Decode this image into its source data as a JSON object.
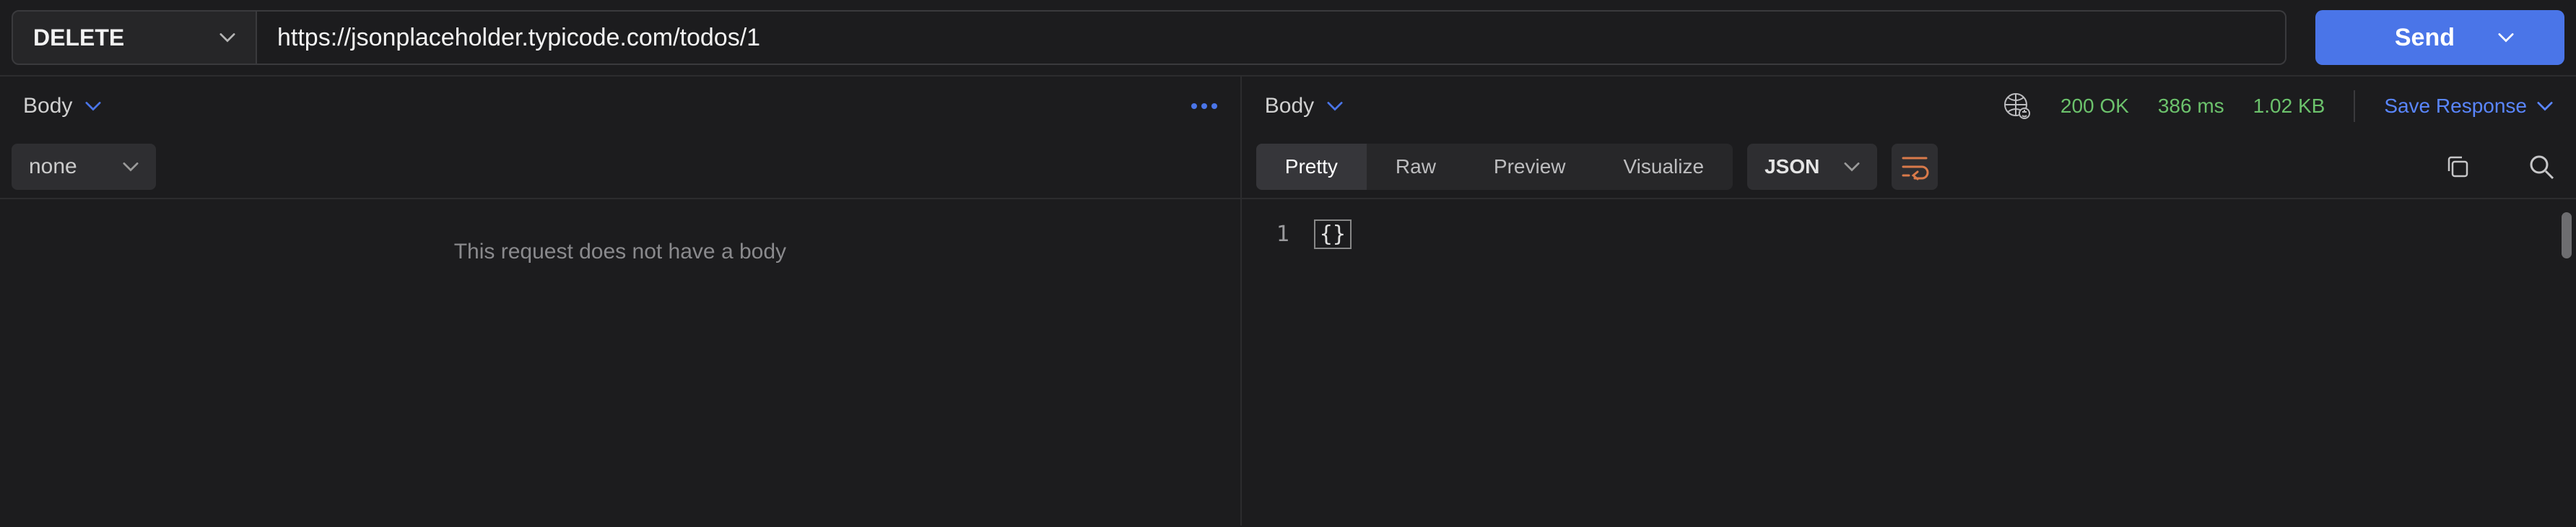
{
  "request": {
    "method": "DELETE",
    "url": "https://jsonplaceholder.typicode.com/todos/1",
    "send_label": "Send"
  },
  "left": {
    "tab_label": "Body",
    "body_type": "none",
    "empty_message": "This request does not have a body"
  },
  "right": {
    "tab_label": "Body",
    "status_code": "200 OK",
    "time": "386 ms",
    "size": "1.02 KB",
    "save_label": "Save Response",
    "view_tabs": {
      "pretty": "Pretty",
      "raw": "Raw",
      "preview": "Preview",
      "visualize": "Visualize"
    },
    "format": "JSON",
    "line_numbers": [
      "1"
    ],
    "body_text": "{}"
  },
  "icons": {
    "more": "more-icon",
    "globe": "network-globe-icon",
    "wrap": "wrap-lines-icon",
    "copy": "copy-icon",
    "search": "search-icon"
  }
}
